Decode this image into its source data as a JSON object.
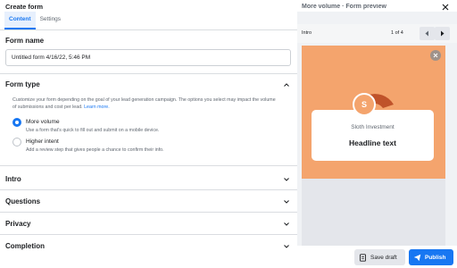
{
  "dialog": {
    "title": "Create form"
  },
  "tabs": [
    {
      "label": "Content",
      "active": true
    },
    {
      "label": "Settings",
      "active": false
    }
  ],
  "form_name": {
    "label": "Form name",
    "value": "Untitled form 4/16/22, 5:46 PM"
  },
  "form_type": {
    "label": "Form type",
    "description": "Customize your form depending on the goal of your lead generation campaign. The options you select may impact the volume of submissions and cost per lead.",
    "learn_more": "Learn more.",
    "options": [
      {
        "label": "More volume",
        "description": "Use a form that's quick to fill out and submit on a mobile device.",
        "selected": true
      },
      {
        "label": "Higher intent",
        "description": "Add a review step that gives people a chance to confirm their info.",
        "selected": false
      }
    ]
  },
  "sections": [
    {
      "label": "Intro"
    },
    {
      "label": "Questions"
    },
    {
      "label": "Privacy"
    },
    {
      "label": "Completion"
    }
  ],
  "preview": {
    "title": "More volume · Form preview",
    "step_label": "Intro",
    "page_count": "1 of 4",
    "avatar_letter": "S",
    "company": "Sloth Investment",
    "headline": "Headline text"
  },
  "footer": {
    "save_draft": "Save draft",
    "publish": "Publish"
  },
  "colors": {
    "accent": "#1877f2",
    "preview_background": "#f4a46d",
    "arc": "#c0532a"
  }
}
